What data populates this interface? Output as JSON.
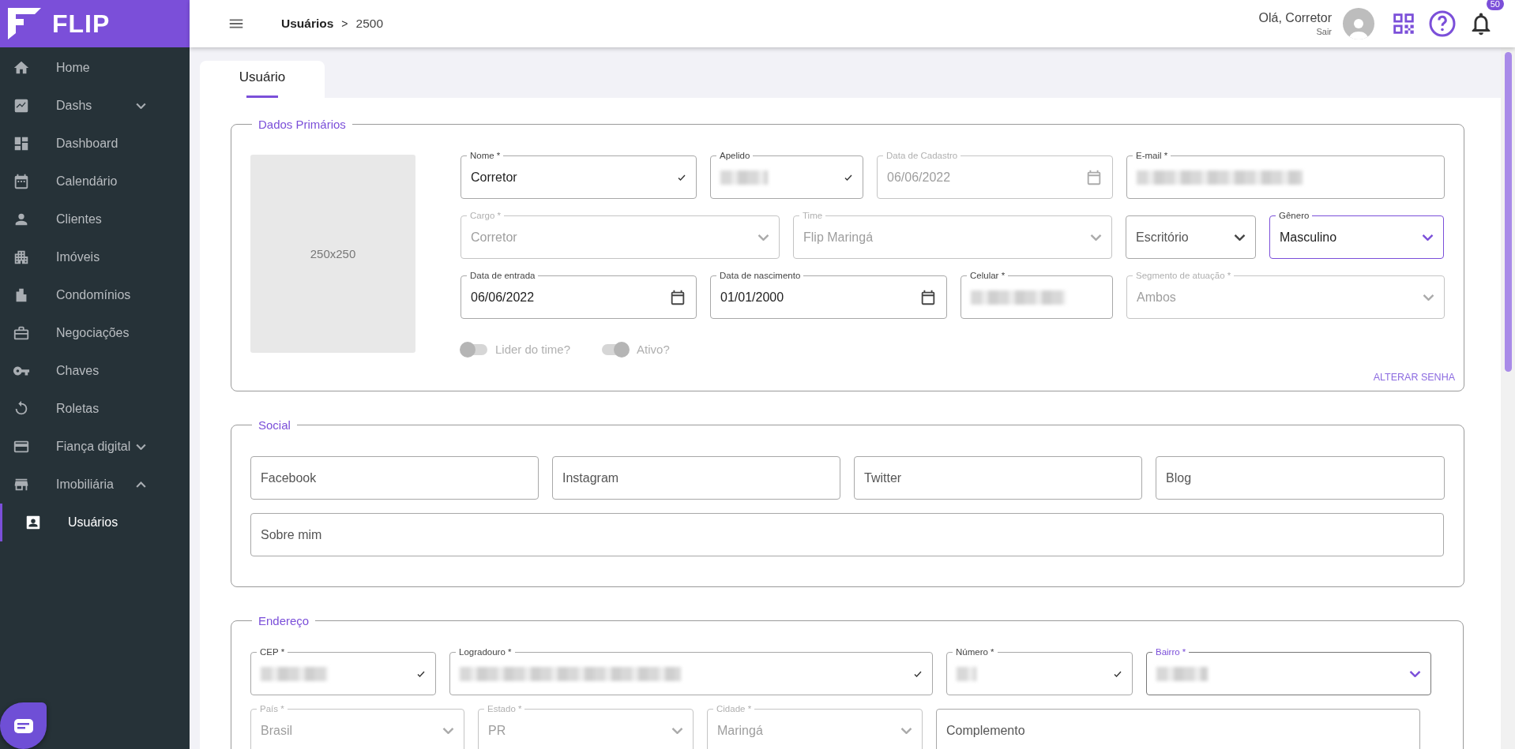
{
  "sidebar": {
    "logo": "FLIP",
    "items": [
      {
        "label": "Home",
        "selected": false
      },
      {
        "label": "Dashs",
        "selected": false,
        "expanded": false
      },
      {
        "label": "Dashboard",
        "selected": false
      },
      {
        "label": "Calendário",
        "selected": false
      },
      {
        "label": "Clientes",
        "selected": false
      },
      {
        "label": "Imóveis",
        "selected": false
      },
      {
        "label": "Condomínios",
        "selected": false
      },
      {
        "label": "Negociações",
        "selected": false
      },
      {
        "label": "Chaves",
        "selected": false
      },
      {
        "label": "Roletas",
        "selected": false
      },
      {
        "label": "Fiança digital",
        "selected": false,
        "expanded": false
      },
      {
        "label": "Imobiliária",
        "selected": false,
        "expanded": true,
        "children": [
          {
            "label": "Usuários",
            "selected": true
          }
        ]
      }
    ]
  },
  "header": {
    "breadcrumb": [
      "Usuários",
      "2500"
    ],
    "breadcrumb_separator": ">",
    "greeting": "Olá, Corretor",
    "logout": "Sair",
    "notification_count": "50"
  },
  "tabs": [
    {
      "label": "Usuário",
      "selected": true
    }
  ],
  "sections": [
    {
      "title": "Dados Primários",
      "photo": {
        "label": "250x250"
      },
      "field_rows": [
        {
          "fields": [
            {
              "label": "Nome *",
              "value": "Corretor",
              "kind": "text",
              "disabled": false,
              "valid": true
            },
            {
              "label": "Apelido",
              "kind": "text",
              "disabled": false,
              "valid": true,
              "redacted": true
            },
            {
              "label": "Data de Cadastro",
              "value": "06/06/2022",
              "kind": "date",
              "disabled": true
            },
            {
              "label": "E-mail *",
              "kind": "text",
              "disabled": false,
              "redacted": true
            }
          ]
        },
        {
          "fields": [
            {
              "label": "Cargo *",
              "value": "Corretor",
              "kind": "select",
              "disabled": true
            },
            {
              "label": "Time",
              "value": "Flip Maringá",
              "kind": "select",
              "disabled": true
            },
            {
              "placeholder": "Escritório",
              "kind": "select",
              "disabled": false
            },
            {
              "label": "Gênero",
              "value": "Masculino",
              "kind": "select",
              "disabled": false,
              "focused": true
            }
          ]
        },
        {
          "fields": [
            {
              "label": "Data de entrada",
              "value": "06/06/2022",
              "kind": "date",
              "disabled": false
            },
            {
              "label": "Data de nascimento",
              "value": "01/01/2000",
              "kind": "date",
              "disabled": false
            },
            {
              "label": "Celular *",
              "kind": "text",
              "disabled": false,
              "redacted": true
            },
            {
              "label": "Segmento de atuação *",
              "value": "Ambos",
              "kind": "select",
              "disabled": true
            }
          ]
        }
      ],
      "toggles": [
        {
          "label": "Lider do time?",
          "on": false,
          "disabled": true
        },
        {
          "label": "Ativo?",
          "on": true,
          "disabled": true
        }
      ],
      "link": "ALTERAR SENHA"
    },
    {
      "title": "Social",
      "field_rows": [
        {
          "fields": [
            {
              "placeholder": "Facebook",
              "kind": "text",
              "disabled": false
            },
            {
              "placeholder": "Instagram",
              "kind": "text",
              "disabled": false
            },
            {
              "placeholder": "Twitter",
              "kind": "text",
              "disabled": false
            },
            {
              "placeholder": "Blog",
              "kind": "text",
              "disabled": false
            }
          ]
        },
        {
          "fields": [
            {
              "placeholder": "Sobre mim",
              "kind": "text",
              "disabled": false
            }
          ]
        }
      ]
    },
    {
      "title": "Endereço",
      "field_rows": [
        {
          "fields": [
            {
              "label": "CEP *",
              "kind": "text",
              "disabled": false,
              "valid": true,
              "redacted": true
            },
            {
              "label": "Logradouro *",
              "kind": "text",
              "disabled": false,
              "valid": true,
              "redacted": true
            },
            {
              "label": "Número *",
              "kind": "text",
              "disabled": false,
              "valid": true,
              "redacted": true
            },
            {
              "label": "Bairro *",
              "kind": "select",
              "disabled": false,
              "redacted": true,
              "highlighted": true
            }
          ]
        },
        {
          "fields": [
            {
              "label": "País *",
              "value": "Brasil",
              "kind": "select",
              "disabled": true
            },
            {
              "label": "Estado *",
              "value": "PR",
              "kind": "select",
              "disabled": true
            },
            {
              "label": "Cidade *",
              "value": "Maringá",
              "kind": "select",
              "disabled": true
            },
            {
              "placeholder": "Complemento",
              "kind": "text",
              "disabled": false
            }
          ]
        }
      ]
    }
  ]
}
